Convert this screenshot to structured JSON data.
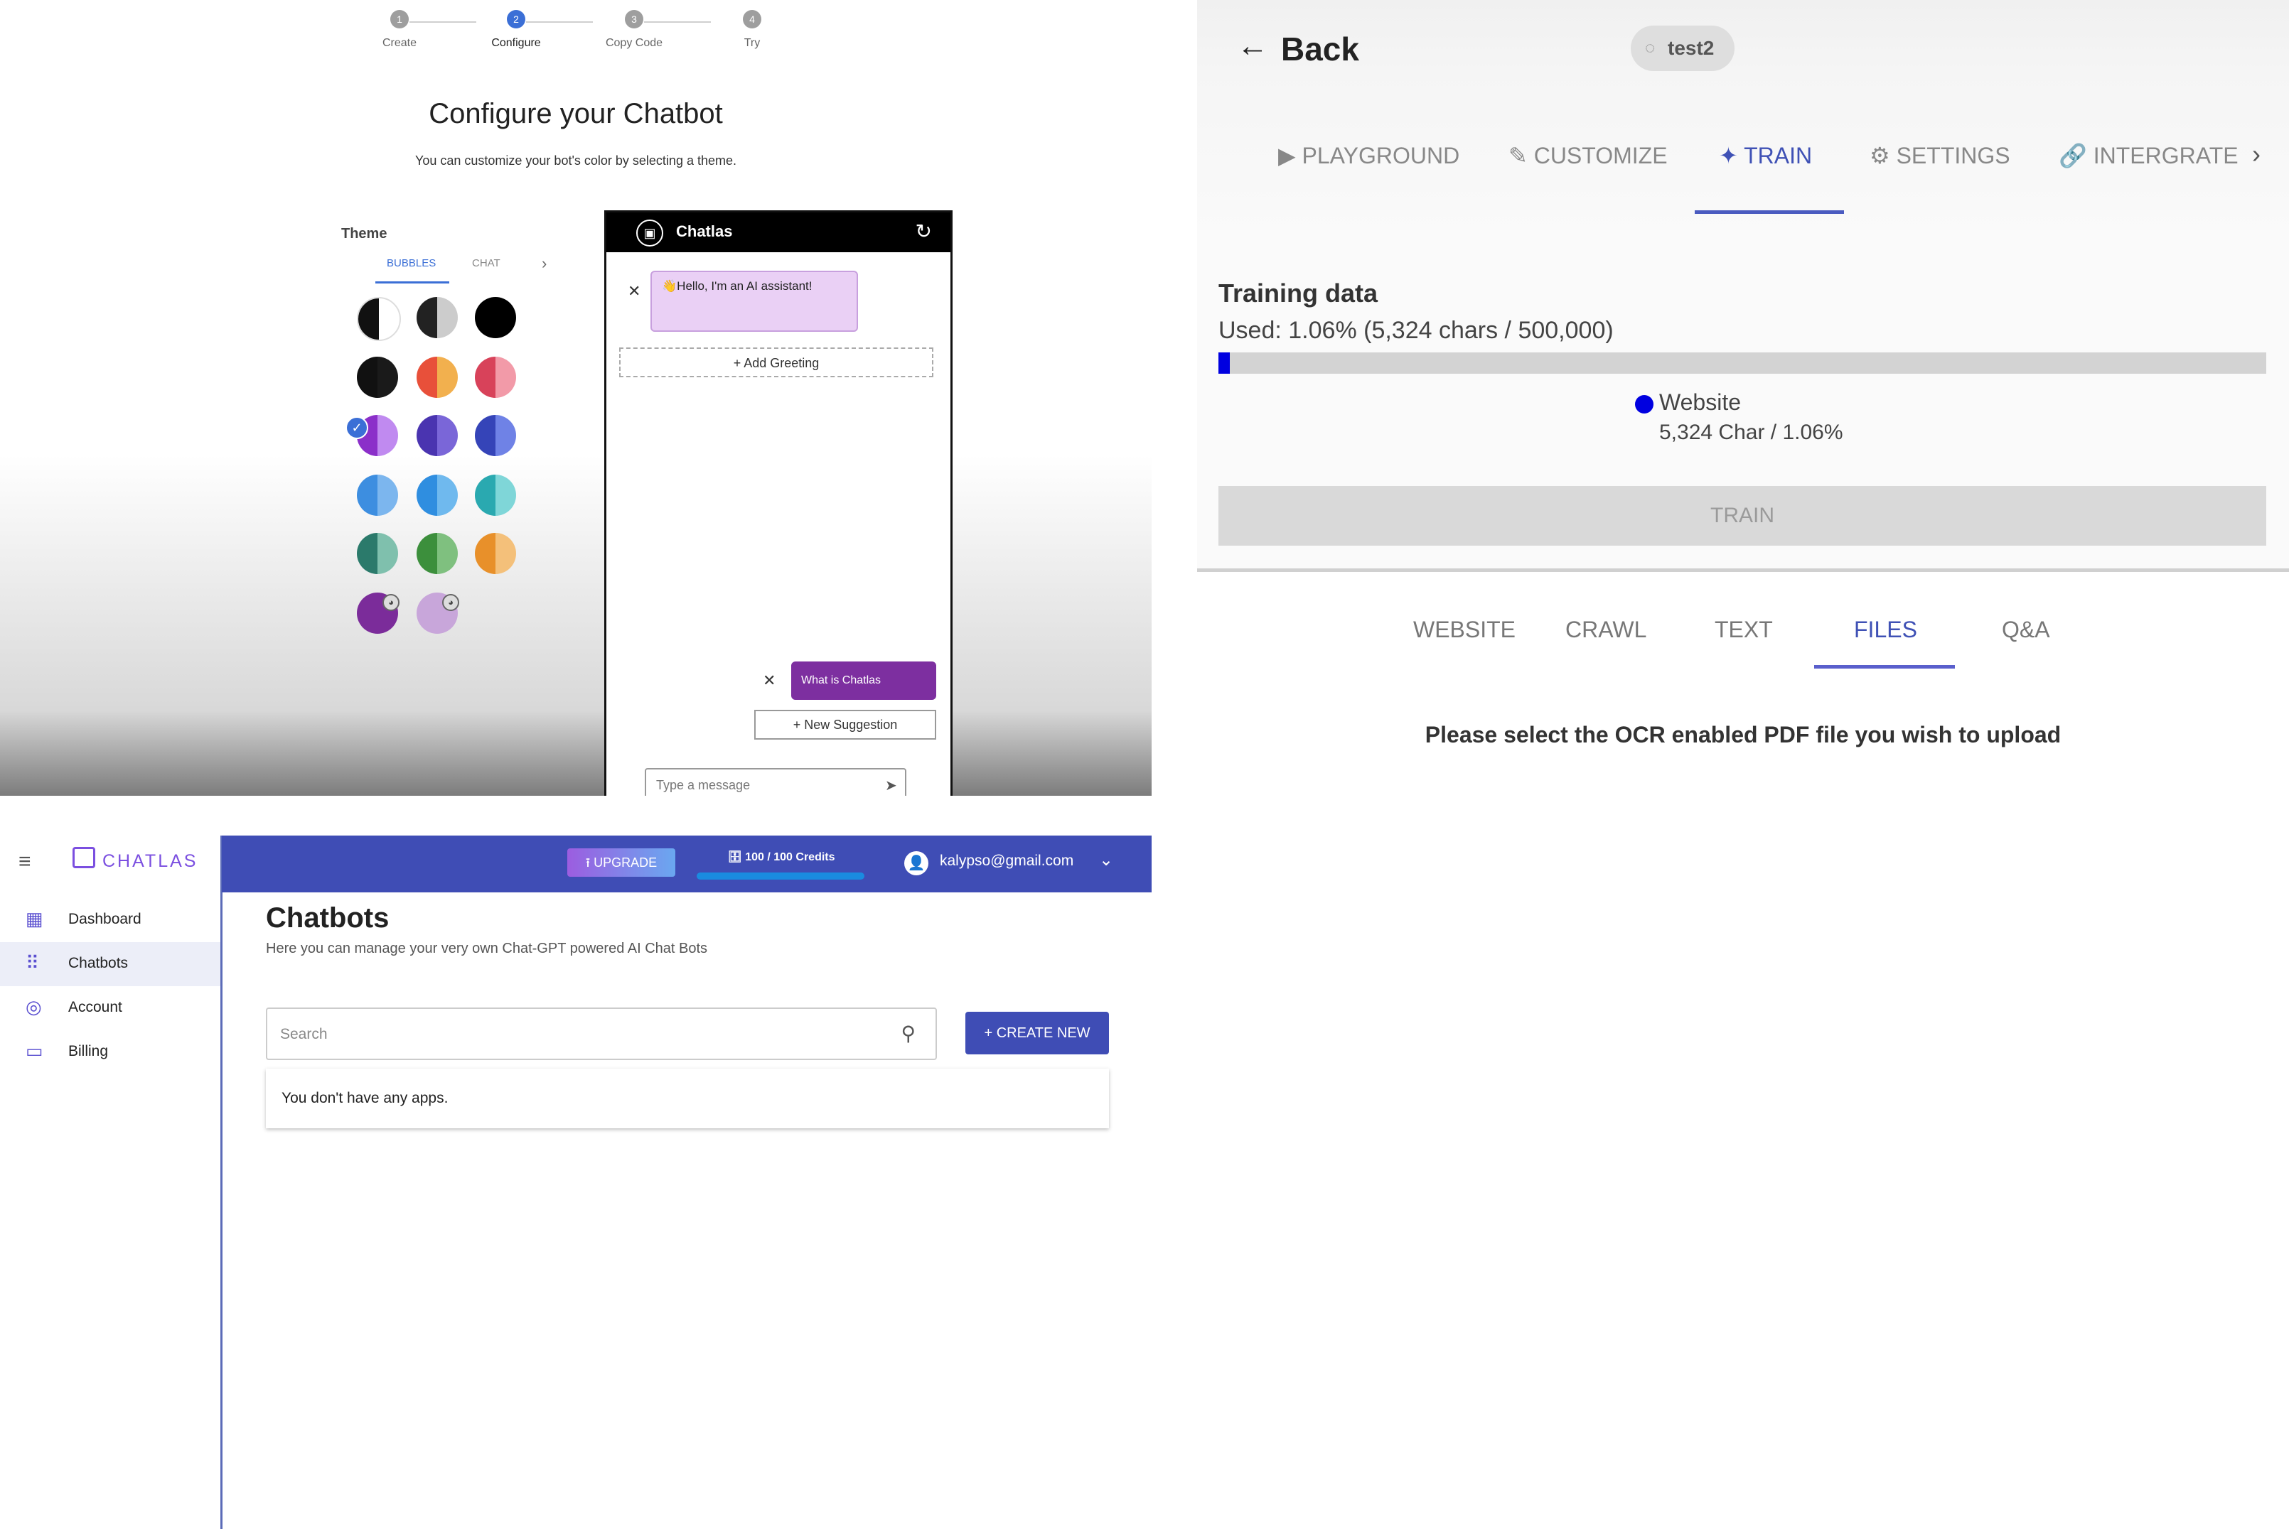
{
  "configure": {
    "steps": [
      {
        "num": "1",
        "label": "Create"
      },
      {
        "num": "2",
        "label": "Configure"
      },
      {
        "num": "3",
        "label": "Copy Code"
      },
      {
        "num": "4",
        "label": "Try"
      }
    ],
    "active_step": 2,
    "title": "Configure your Chatbot",
    "subtitle": "You can customize your bot's color by selecting a theme.",
    "theme_label": "Theme",
    "theme_tabs": [
      "BUBBLES",
      "CHAT"
    ],
    "theme_tab_next": "›",
    "swatches": [
      [
        "#111111",
        "#ffffff"
      ],
      [
        "#222222",
        "#cccccc"
      ],
      [
        "#000000",
        "#000000"
      ],
      [
        "#111111",
        "#1a1a1a"
      ],
      [
        "#e8503a",
        "#f2b04e"
      ],
      [
        "#d8425a",
        "#f29aa8"
      ],
      [
        "#8b2fc9",
        "#c08af0"
      ],
      [
        "#4a34b0",
        "#7a66d8"
      ],
      [
        "#3544b8",
        "#6f82e6"
      ],
      [
        "#3d8ee0",
        "#7cb6ee"
      ],
      [
        "#2f8ee0",
        "#6fb9ee"
      ],
      [
        "#2aa9b0",
        "#7fd6d8"
      ],
      [
        "#2b7a6b",
        "#7fc0ad"
      ],
      [
        "#3c8f3c",
        "#7fc07f"
      ],
      [
        "#e8902a",
        "#f4c07a"
      ],
      [
        "#7b2c9a",
        "#7b2c9a"
      ],
      [
        "#c8a6da",
        "#c8a6da"
      ]
    ],
    "selected_swatch_check": "✓",
    "palette_icon": "palette-icon",
    "chat": {
      "bot_name": "Chatlas",
      "refresh_icon": "↻",
      "logo_glyph": "▣",
      "greeting": "👋Hello, I'm an AI assistant!",
      "add_greeting": "+ Add Greeting",
      "suggestion": "What is Chatlas",
      "new_suggestion": "+ New Suggestion",
      "close_glyph": "✕",
      "input_placeholder": "Type a message",
      "send_icon": "➤"
    }
  },
  "train": {
    "back_label": "Back",
    "back_icon": "←",
    "bot_chip": "test2",
    "chip_icon": "◌",
    "nav_tabs": [
      {
        "icon": "▶",
        "label": "PLAYGROUND"
      },
      {
        "icon": "✎",
        "label": "CUSTOMIZE"
      },
      {
        "icon": "✦",
        "label": "TRAIN"
      },
      {
        "icon": "⚙",
        "label": "SETTINGS"
      },
      {
        "icon": "🔗",
        "label": "INTERGRATE"
      }
    ],
    "active_nav": "TRAIN",
    "nav_next": "›",
    "training_title": "Training data",
    "usage_text": "Used: 1.06% (5,324 chars / 500,000)",
    "usage_fraction": 0.0106,
    "source_label": "Website",
    "source_value": "5,324 Char / 1.06%",
    "source_color": "#0000e0",
    "train_button": "TRAIN",
    "source_tabs": [
      "WEBSITE",
      "CRAWL",
      "TEXT",
      "FILES",
      "Q&A"
    ],
    "active_source_tab": "FILES",
    "files_message": "Please select the OCR enabled PDF file you wish to upload"
  },
  "dashboard": {
    "brand": "CHATLAS",
    "menu_icon": "≡",
    "nav": [
      {
        "icon": "▦",
        "label": "Dashboard"
      },
      {
        "icon": "⠿",
        "label": "Chatbots"
      },
      {
        "icon": "◎",
        "label": "Account"
      },
      {
        "icon": "▭",
        "label": "Billing"
      }
    ],
    "active_nav": "Chatbots",
    "upgrade_label": "⭱  UPGRADE",
    "credits_label": "🗄 100 / 100 Credits",
    "credits_fraction": 1.0,
    "user_icon": "👤",
    "user_email": "kalypso@gmail.com",
    "user_chevron": "⌄",
    "page_title": "Chatbots",
    "page_subtitle": "Here you can manage your very own Chat-GPT powered AI Chat Bots",
    "search_placeholder": "Search",
    "search_icon": "⚲",
    "create_button": "+  CREATE NEW",
    "empty_message": "You don't have any apps.",
    "accent_color": "#3f4db5"
  }
}
